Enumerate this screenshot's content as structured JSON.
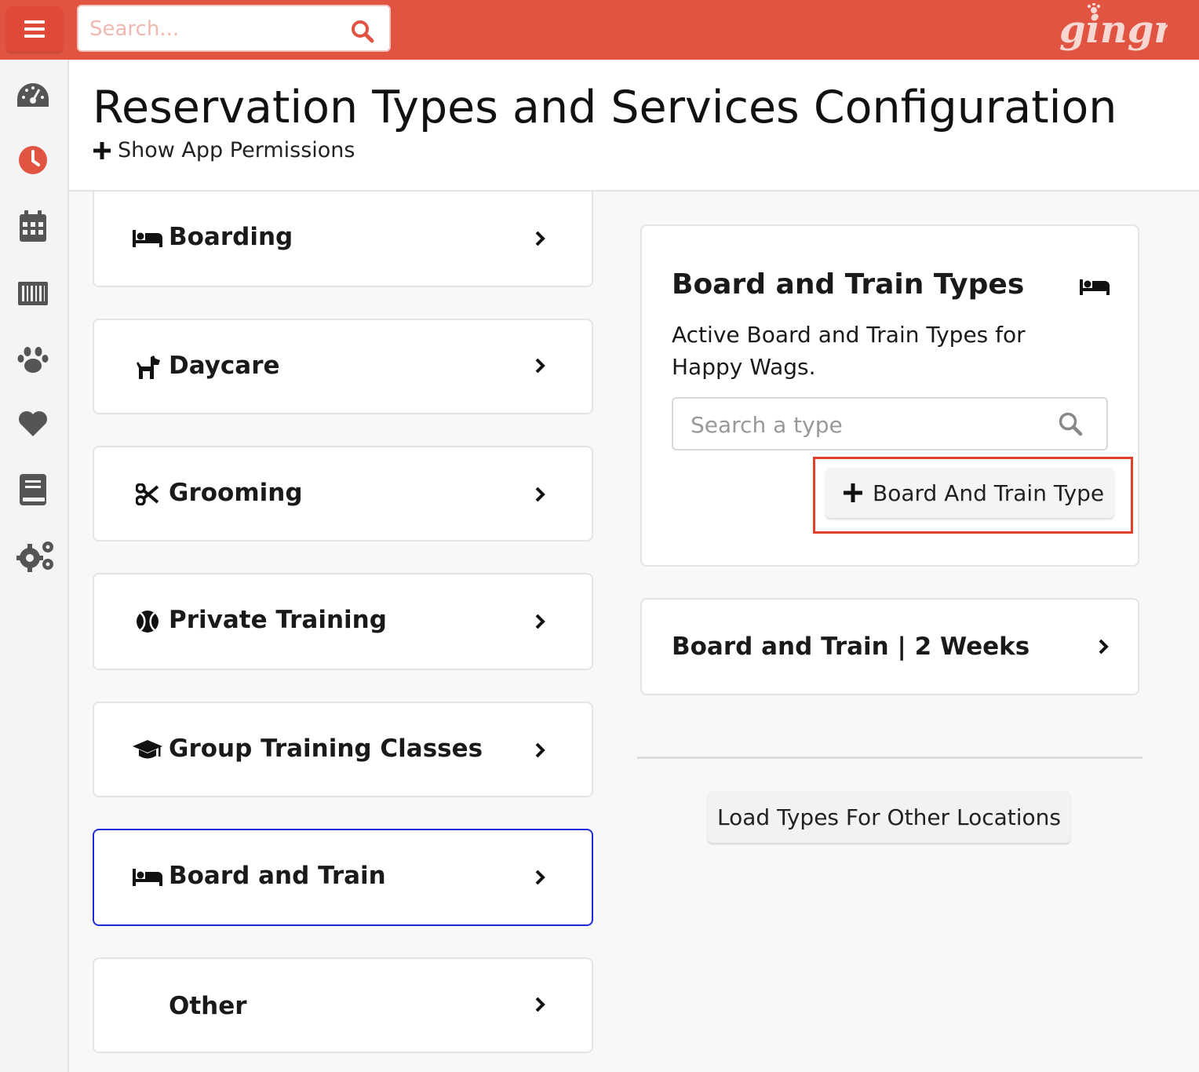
{
  "topbar": {
    "search_placeholder": "Search...",
    "logo_text": "gingr",
    "menu_icon": "hamburger-icon",
    "brand_color": "#e25442"
  },
  "sidebar": {
    "items": [
      {
        "name": "dashboard",
        "icon": "gauge-icon"
      },
      {
        "name": "clock",
        "icon": "clock-icon",
        "color": "#e25442"
      },
      {
        "name": "calendar",
        "icon": "calendar-icon"
      },
      {
        "name": "barcode",
        "icon": "barcode-icon"
      },
      {
        "name": "animals",
        "icon": "paw-icon"
      },
      {
        "name": "favorites",
        "icon": "heart-icon"
      },
      {
        "name": "reports",
        "icon": "book-icon"
      },
      {
        "name": "settings",
        "icon": "gears-icon"
      }
    ]
  },
  "header": {
    "title": "Reservation Types and Services Configuration",
    "permissions_link": "Show App Permissions"
  },
  "types": [
    {
      "label": "Boarding",
      "icon": "bed-icon"
    },
    {
      "label": "Daycare",
      "icon": "dog-icon"
    },
    {
      "label": "Grooming",
      "icon": "scissors-icon"
    },
    {
      "label": "Private Training",
      "icon": "tennis-ball-icon"
    },
    {
      "label": "Group Training Classes",
      "icon": "graduation-cap-icon"
    },
    {
      "label": "Board and Train",
      "icon": "bed-icon",
      "active": true
    },
    {
      "label": "Other",
      "icon": ""
    }
  ],
  "panel": {
    "title": "Board and Train Types",
    "description": "Active Board and Train Types for Happy Wags.",
    "search_placeholder": "Search a type",
    "add_button": "Board And Train Type",
    "highlight_color": "#e0402c"
  },
  "results": [
    {
      "label": "Board and Train | 2 Weeks"
    }
  ],
  "load_button": "Load Types For Other Locations"
}
